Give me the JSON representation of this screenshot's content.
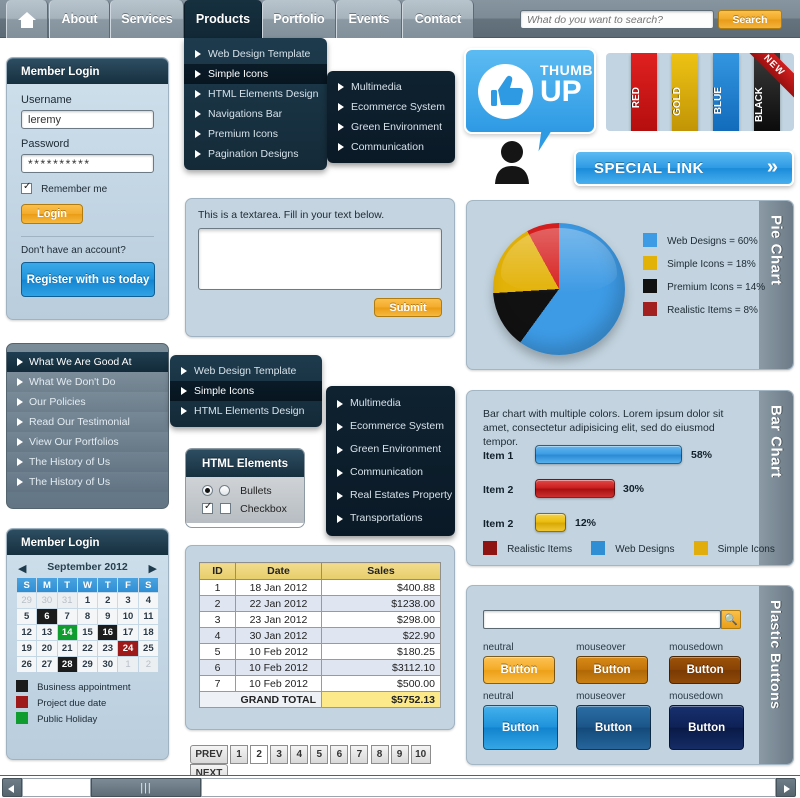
{
  "topnav": {
    "home_icon": "home-icon",
    "items": [
      {
        "label": "About",
        "active": false
      },
      {
        "label": "Services",
        "active": false
      },
      {
        "label": "Products",
        "active": true
      },
      {
        "label": "Portfolio",
        "active": false
      },
      {
        "label": "Events",
        "active": false
      },
      {
        "label": "Contact",
        "active": false
      }
    ],
    "search": {
      "placeholder": "What do you want to search?",
      "value": "",
      "button_label": "Search"
    }
  },
  "products_menu": {
    "items": [
      {
        "label": "Web Design Template",
        "selected": false
      },
      {
        "label": "Simple Icons",
        "selected": true
      },
      {
        "label": "HTML Elements Design",
        "selected": false
      },
      {
        "label": "Navigations Bar",
        "selected": false
      },
      {
        "label": "Premium Icons",
        "selected": false
      },
      {
        "label": "Pagination Designs",
        "selected": false
      }
    ]
  },
  "products_submenu": {
    "items": [
      {
        "label": "Multimedia"
      },
      {
        "label": "Ecommerce System"
      },
      {
        "label": "Green Environment"
      },
      {
        "label": "Communication"
      }
    ]
  },
  "login": {
    "title": "Member Login",
    "username_label": "Username",
    "username_value": "leremy",
    "password_label": "Password",
    "password_value": "**********",
    "remember_label": "Remember me",
    "remember_checked": true,
    "login_button": "Login",
    "no_account_text": "Don't have an account?",
    "register_button": "Register with us today"
  },
  "textarea_panel": {
    "caption": "This is a textarea. Fill in your text below.",
    "value": "",
    "submit_label": "Submit"
  },
  "accordion": {
    "items": [
      {
        "label": "What We Are Good At",
        "selected": true
      },
      {
        "label": "What We Don't Do",
        "selected": false
      },
      {
        "label": "Our Policies",
        "selected": false
      },
      {
        "label": "Read Our Testimonial",
        "selected": false
      },
      {
        "label": "View Our Portfolios",
        "selected": false
      },
      {
        "label": "The History of Us",
        "selected": false
      },
      {
        "label": "The History of Us",
        "selected": false
      }
    ]
  },
  "vertical_menu": {
    "items": [
      {
        "label": "Web Design Template",
        "selected": false
      },
      {
        "label": "Simple Icons",
        "selected": true
      },
      {
        "label": "HTML Elements Design",
        "selected": false
      }
    ]
  },
  "vertical_submenu": {
    "items": [
      {
        "label": "Multimedia"
      },
      {
        "label": "Ecommerce System"
      },
      {
        "label": "Green Environment"
      },
      {
        "label": "Communication"
      },
      {
        "label": "Real Estates Property"
      },
      {
        "label": "Transportations"
      }
    ]
  },
  "html_elements": {
    "title": "HTML Elements",
    "radio_label": "Bullets",
    "radio_on_checked": true,
    "radio_off_checked": false,
    "checkbox_label": "Checkbox",
    "checkbox_on_checked": true,
    "checkbox_off_checked": false
  },
  "sales_table": {
    "columns": [
      "ID",
      "Date",
      "Sales"
    ],
    "rows": [
      {
        "id": "1",
        "date": "18 Jan 2012",
        "sales": "$400.88"
      },
      {
        "id": "2",
        "date": "22 Jan 2012",
        "sales": "$1238.00"
      },
      {
        "id": "3",
        "date": "23 Jan 2012",
        "sales": "$298.00"
      },
      {
        "id": "4",
        "date": "30 Jan 2012",
        "sales": "$22.90"
      },
      {
        "id": "5",
        "date": "10 Feb 2012",
        "sales": "$180.25"
      },
      {
        "id": "6",
        "date": "10 Feb 2012",
        "sales": "$3112.10"
      },
      {
        "id": "7",
        "date": "10 Feb 2012",
        "sales": "$500.00"
      }
    ],
    "total_label": "GRAND TOTAL",
    "total_value": "$5752.13"
  },
  "pagination": {
    "prev_label": "PREV",
    "next_label": "NEXT",
    "pages": [
      "1",
      "2",
      "3",
      "4",
      "5",
      "6",
      "7",
      "8",
      "9",
      "10"
    ],
    "current": "2"
  },
  "calendar": {
    "title": "Member Login",
    "month_label": "September 2012",
    "prev_icon": "chevron-left-icon",
    "next_icon": "chevron-right-icon",
    "weekdays": [
      "S",
      "M",
      "T",
      "W",
      "T",
      "F",
      "S"
    ],
    "weeks": [
      [
        {
          "d": "29",
          "t": "out"
        },
        {
          "d": "30",
          "t": "out"
        },
        {
          "d": "31",
          "t": "out"
        },
        {
          "d": "1",
          "t": ""
        },
        {
          "d": "2",
          "t": ""
        },
        {
          "d": "3",
          "t": ""
        },
        {
          "d": "4",
          "t": ""
        }
      ],
      [
        {
          "d": "5",
          "t": ""
        },
        {
          "d": "6",
          "t": "blk"
        },
        {
          "d": "7",
          "t": ""
        },
        {
          "d": "8",
          "t": ""
        },
        {
          "d": "9",
          "t": ""
        },
        {
          "d": "10",
          "t": ""
        },
        {
          "d": "11",
          "t": ""
        }
      ],
      [
        {
          "d": "12",
          "t": ""
        },
        {
          "d": "13",
          "t": ""
        },
        {
          "d": "14",
          "t": "grn"
        },
        {
          "d": "15",
          "t": ""
        },
        {
          "d": "16",
          "t": "blk"
        },
        {
          "d": "17",
          "t": ""
        },
        {
          "d": "18",
          "t": ""
        }
      ],
      [
        {
          "d": "19",
          "t": ""
        },
        {
          "d": "20",
          "t": ""
        },
        {
          "d": "21",
          "t": ""
        },
        {
          "d": "22",
          "t": ""
        },
        {
          "d": "23",
          "t": ""
        },
        {
          "d": "24",
          "t": "red"
        },
        {
          "d": "25",
          "t": ""
        }
      ],
      [
        {
          "d": "26",
          "t": ""
        },
        {
          "d": "27",
          "t": ""
        },
        {
          "d": "28",
          "t": "blk"
        },
        {
          "d": "29",
          "t": ""
        },
        {
          "d": "30",
          "t": ""
        },
        {
          "d": "1",
          "t": "out"
        },
        {
          "d": "2",
          "t": "out"
        }
      ]
    ],
    "legend": [
      {
        "label": "Business appointment",
        "color": "#1c1c1c"
      },
      {
        "label": "Project due date",
        "color": "#9e1a1a"
      },
      {
        "label": "Public Holiday",
        "color": "#119c2f"
      }
    ]
  },
  "thumb_up": {
    "line1": "THUMB",
    "line2": "UP",
    "icon": "thumbs-up-icon",
    "avatar_icon": "user-avatar-icon"
  },
  "color_tabs": {
    "ribbon_label": "NEW",
    "items": [
      {
        "label": "RED",
        "color": "#cf1212"
      },
      {
        "label": "GOLD",
        "color": "#d8aa0a"
      },
      {
        "label": "BLUE",
        "color": "#1f83cf"
      },
      {
        "label": "BLACK",
        "color": "#191919"
      }
    ]
  },
  "special_link": {
    "label": "SPECIAL LINK",
    "chevron_icon": "double-chevron-right-icon"
  },
  "pie_panel": {
    "tab_label": "Pie Chart"
  },
  "bar_panel": {
    "tab_label": "Bar Chart",
    "description": "Bar chart with multiple colors. Lorem ipsum dolor sit amet, consectetur adipisicing elit, sed do eiusmod tempor."
  },
  "plastic_panel": {
    "tab_label": "Plastic Buttons",
    "search_value": "",
    "search_icon": "magnifier-icon",
    "rows": [
      {
        "state": "neutral",
        "label": "Button"
      },
      {
        "state": "mouseover",
        "label": "Button"
      },
      {
        "state": "mousedown",
        "label": "Button"
      }
    ],
    "rows2": [
      {
        "state": "neutral",
        "label": "Button"
      },
      {
        "state": "mouseover",
        "label": "Button"
      },
      {
        "state": "mousedown",
        "label": "Button"
      }
    ]
  },
  "scrollbar": {
    "left_icon": "triangle-left-icon",
    "right_icon": "triangle-right-icon"
  },
  "chart_data": [
    {
      "type": "pie",
      "title": "Pie Chart",
      "categories": [
        "Web Designs",
        "Simple Icons",
        "Premium Icons",
        "Realistic Items"
      ],
      "values": [
        60,
        18,
        14,
        8
      ],
      "unit": "%",
      "colors": [
        "#3d9ae4",
        "#e3b208",
        "#111111",
        "#a32020"
      ],
      "legend_labels": [
        "Web Designs = 60%",
        "Simple Icons = 18%",
        "Premium Icons = 14%",
        "Realistic Items = 8%"
      ],
      "legend_position": "right"
    },
    {
      "type": "bar",
      "title": "Bar Chart",
      "orientation": "horizontal",
      "categories": [
        "Item 1",
        "Item 2",
        "Item 2"
      ],
      "values": [
        58,
        30,
        12
      ],
      "value_labels": [
        "58%",
        "30%",
        "12%"
      ],
      "unit": "%",
      "xlim": [
        0,
        100
      ],
      "colors": [
        "#3f9ee4",
        "#cc1f1f",
        "#ecbd10"
      ],
      "grid": false,
      "legend_position": "bottom",
      "legend": [
        {
          "label": "Realistic Items",
          "color": "#8e1414"
        },
        {
          "label": "Web Designs",
          "color": "#2f8ed4"
        },
        {
          "label": "Simple Icons",
          "color": "#e0ad0c"
        }
      ]
    },
    {
      "type": "table",
      "title": "Sales",
      "columns": [
        "ID",
        "Date",
        "Sales"
      ],
      "rows": [
        [
          "1",
          "18 Jan 2012",
          "$400.88"
        ],
        [
          "2",
          "22 Jan 2012",
          "$1238.00"
        ],
        [
          "3",
          "23 Jan 2012",
          "$298.00"
        ],
        [
          "4",
          "30 Jan 2012",
          "$22.90"
        ],
        [
          "5",
          "10 Feb 2012",
          "$180.25"
        ],
        [
          "6",
          "10 Feb 2012",
          "$3112.10"
        ],
        [
          "7",
          "10 Feb 2012",
          "$500.00"
        ]
      ],
      "total_row": [
        "GRAND TOTAL",
        "$5752.13"
      ]
    }
  ]
}
